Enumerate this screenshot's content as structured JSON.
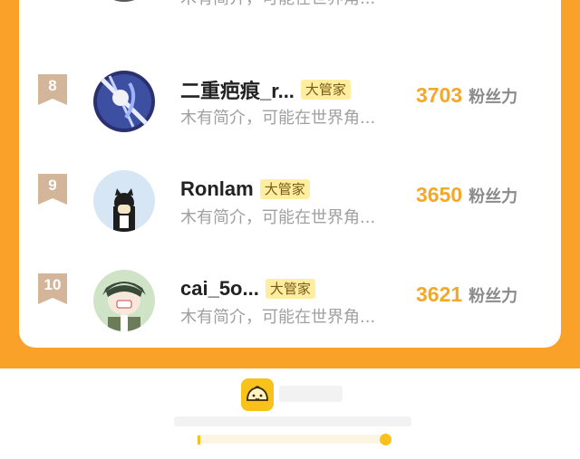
{
  "leaderboard": {
    "partial_top_bio": "木有简介，可能在世界角...",
    "rows": [
      {
        "rank": "8",
        "username": "二重疤痕_r...",
        "role": "大管家",
        "bio": "木有简介，可能在世界角...",
        "fans": "3703",
        "fans_label": "粉丝力"
      },
      {
        "rank": "9",
        "username": "Ronlam",
        "role": "大管家",
        "bio": "木有简介，可能在世界角...",
        "fans": "3650",
        "fans_label": "粉丝力"
      },
      {
        "rank": "10",
        "username": "cai_5o...",
        "role": "大管家",
        "bio": "木有简介，可能在世界角...",
        "fans": "3621",
        "fans_label": "粉丝力"
      }
    ]
  },
  "colors": {
    "background_orange": "#f9a128",
    "fans_count": "#f3a828",
    "role_badge_bg": "#ffeea0",
    "rank_badge": "#d3b59a",
    "logo_yellow": "#f9c21a"
  },
  "icons": {
    "rank_badge": "bookmark-ribbon-icon",
    "footer_logo": "steamed-bun-mascot-icon"
  }
}
